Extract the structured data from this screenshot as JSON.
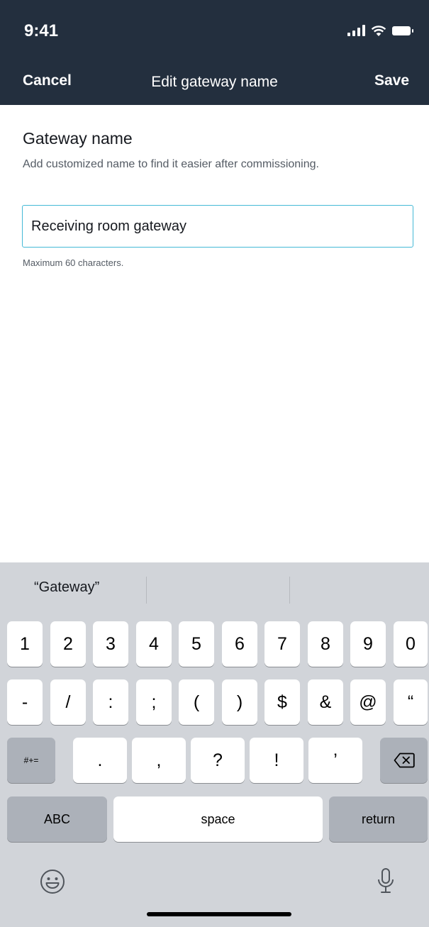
{
  "status_bar": {
    "time": "9:41"
  },
  "nav": {
    "cancel_label": "Cancel",
    "title": "Edit gateway name",
    "save_label": "Save"
  },
  "form": {
    "label": "Gateway name",
    "description": "Add customized name to find it easier after commissioning.",
    "input_value": "Receiving room gateway",
    "hint": "Maximum 60 characters.",
    "accent_color": "#44b9d6"
  },
  "keyboard": {
    "suggestion": "“Gateway”",
    "row1": [
      "1",
      "2",
      "3",
      "4",
      "5",
      "6",
      "7",
      "8",
      "9",
      "0"
    ],
    "row2": [
      "-",
      "/",
      ":",
      ";",
      "(",
      ")",
      "$",
      "&",
      "@",
      "“"
    ],
    "row3": {
      "symbols_label": "#+=",
      "keys": [
        ".",
        ",",
        "?",
        "!",
        "’"
      ],
      "delete_icon": "backspace-icon"
    },
    "row4": {
      "abc_label": "ABC",
      "space_label": "space",
      "return_label": "return"
    },
    "bottom": {
      "emoji_icon": "emoji-icon",
      "mic_icon": "microphone-icon"
    }
  },
  "colors": {
    "header_bg": "#232f3e",
    "keyboard_bg": "#d1d4d9"
  }
}
